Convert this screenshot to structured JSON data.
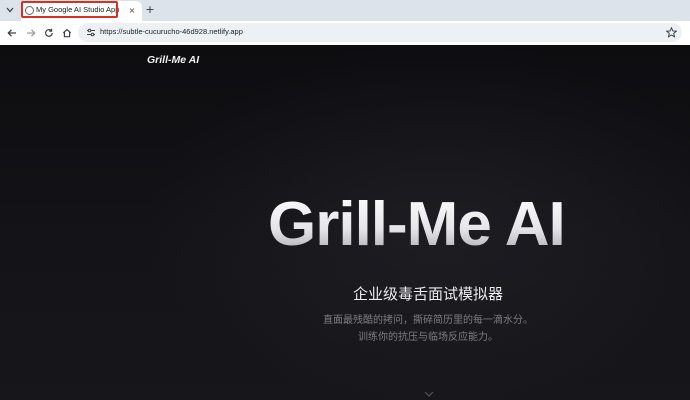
{
  "browser": {
    "tab": {
      "title": "My Google AI Studio App"
    },
    "new_tab_symbol": "+",
    "close_symbol": "×",
    "url": "https://subtle-cucurucho-46d928.netlify.app",
    "icons": {
      "tab_menu": "chevron-down-icon",
      "favicon": "globe-icon",
      "back": "arrow-left-icon",
      "forward": "arrow-right-icon",
      "reload": "reload-icon",
      "home": "home-icon",
      "site_info": "tune-icon",
      "bookmark": "star-icon"
    }
  },
  "page": {
    "nav": {
      "logo": "Grill-Me AI"
    },
    "hero": {
      "title": "Grill-Me AI",
      "subtitle": "企业级毒舌面试模拟器",
      "description_line_1": "直面最残酷的拷问，撕碎简历里的每一滴水分。",
      "description_line_2": "训练你的抗压与临场反应能力。"
    }
  }
}
